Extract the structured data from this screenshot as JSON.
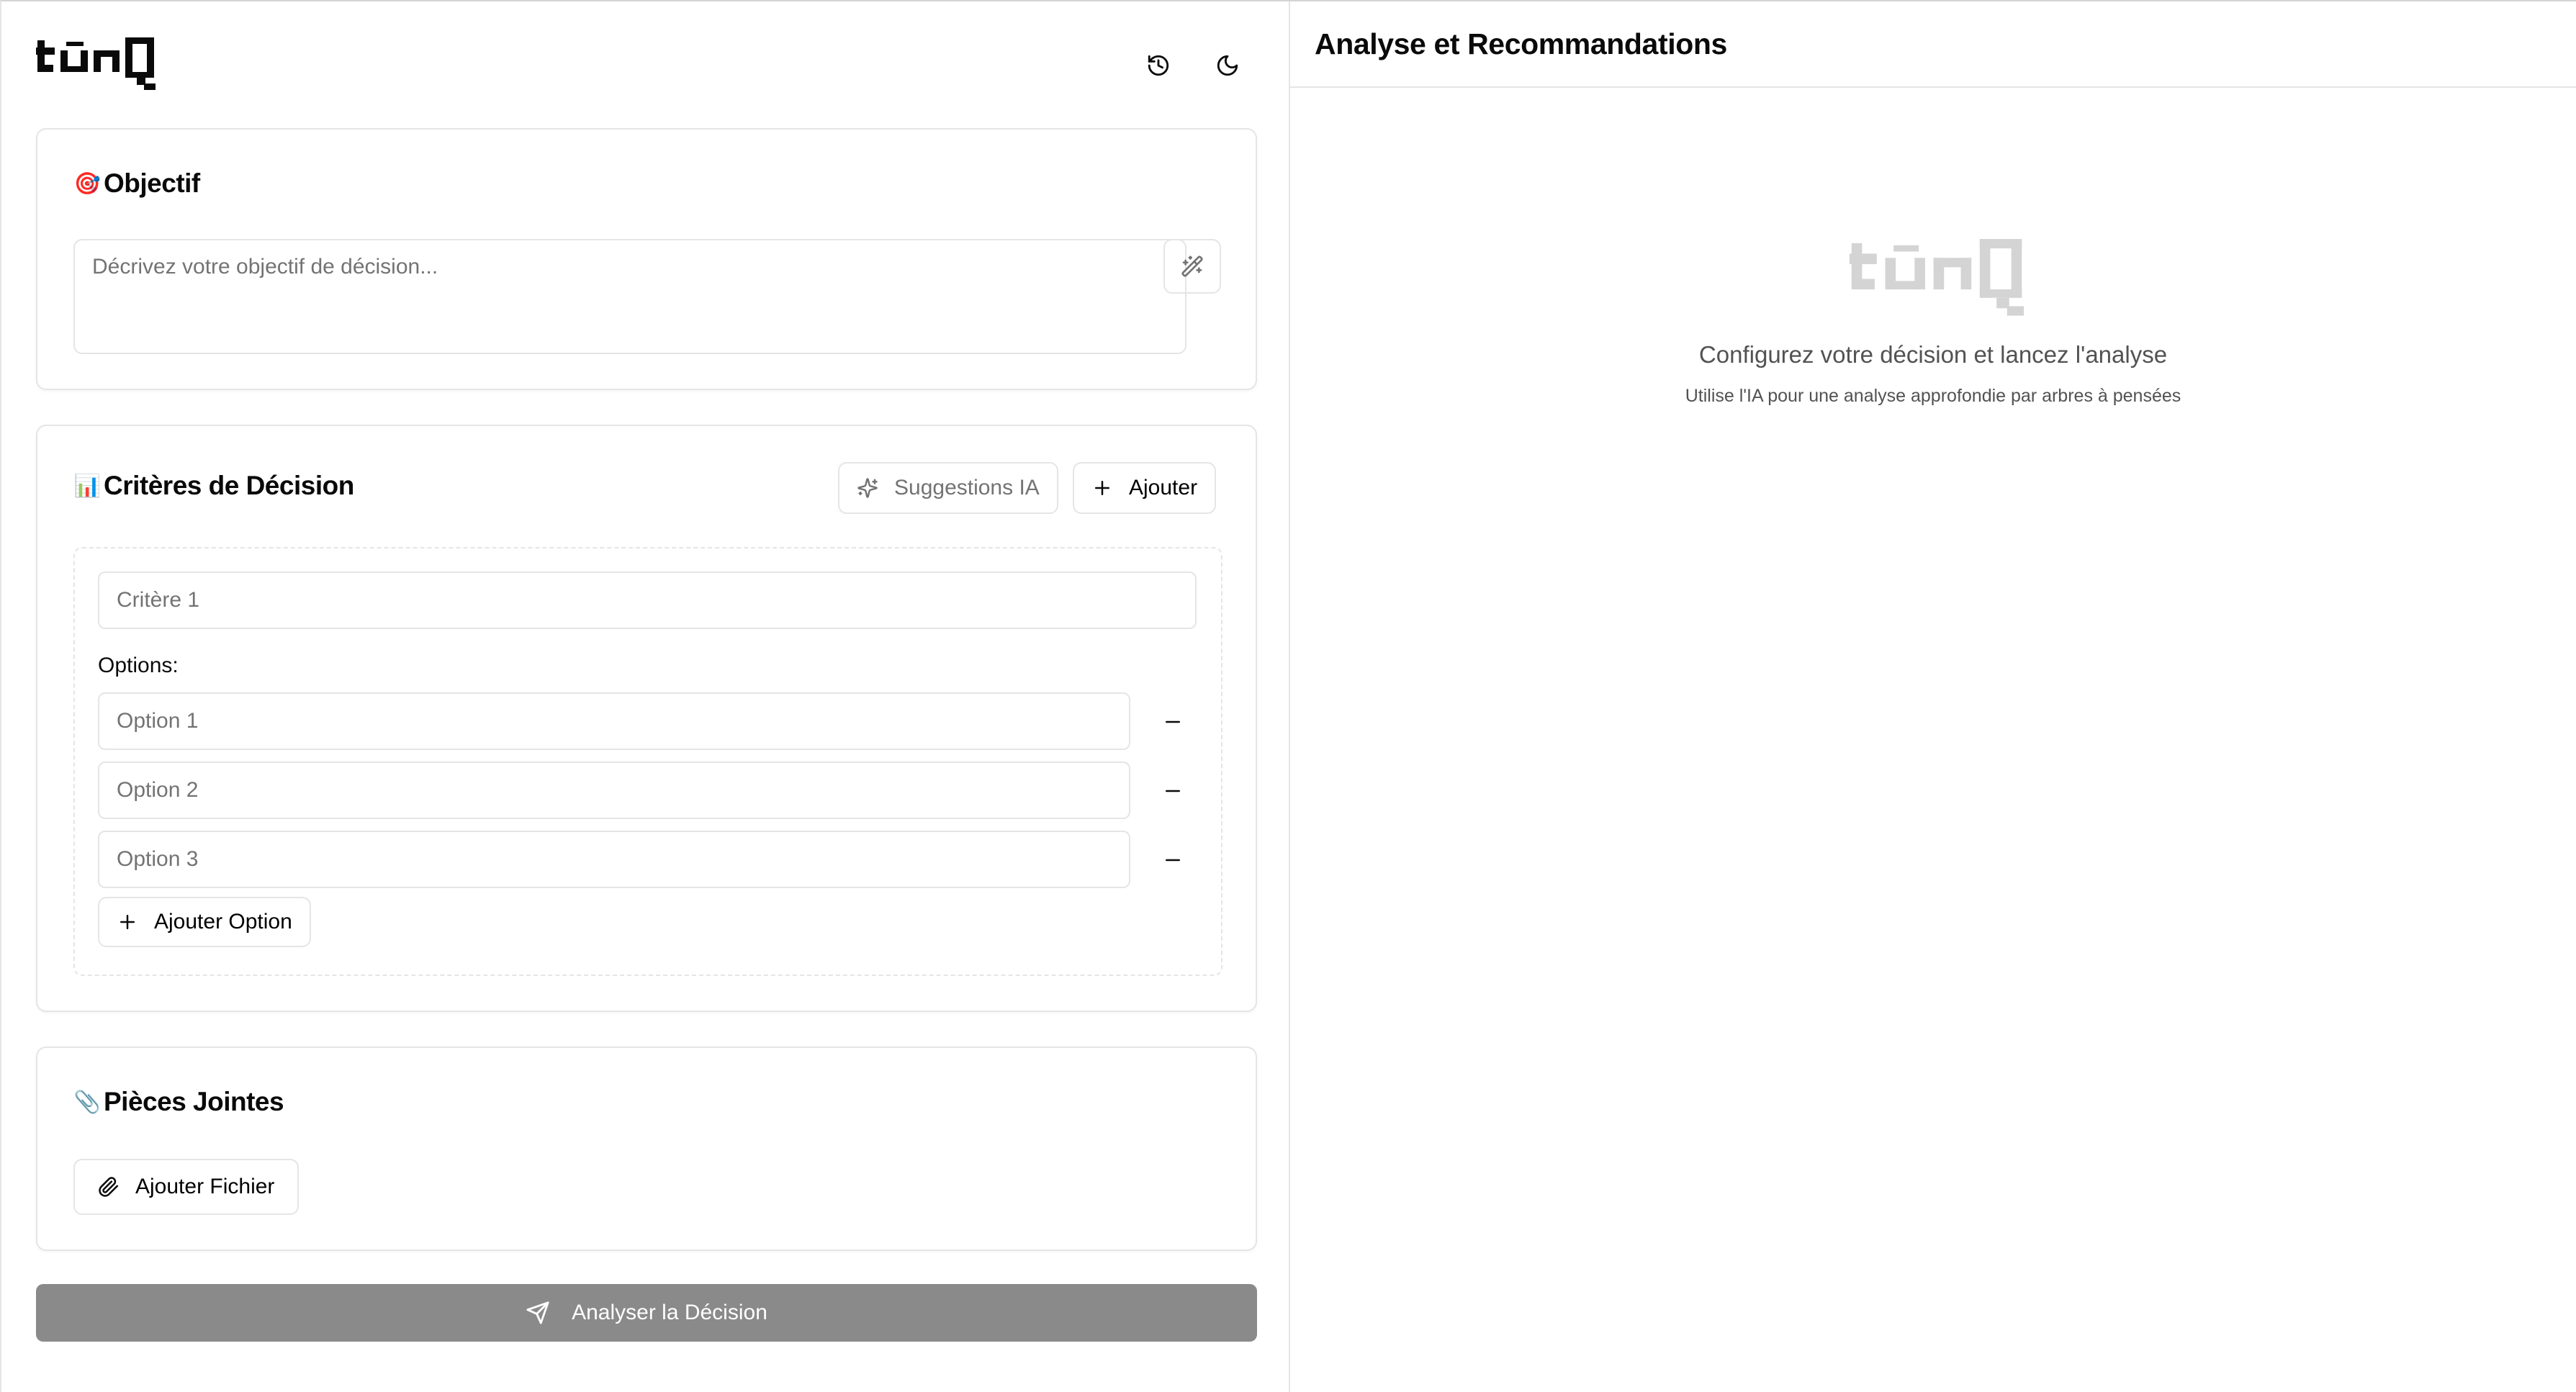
{
  "header": {
    "logo_text": "tūnQ",
    "history_icon": "history-icon",
    "theme_icon": "moon-icon"
  },
  "objective": {
    "title": "Objectif",
    "emoji": "🎯",
    "placeholder": "Décrivez votre objectif de décision...",
    "wand_icon": "wand-sparkles-icon"
  },
  "criteria": {
    "title": "Critères de Décision",
    "emoji": "📊",
    "suggestions_label": "Suggestions IA",
    "add_label": "Ajouter",
    "criterion_placeholder": "Critère 1",
    "options_label": "Options:",
    "options": [
      {
        "placeholder": "Option 1"
      },
      {
        "placeholder": "Option 2"
      },
      {
        "placeholder": "Option 3"
      }
    ],
    "add_option_label": "Ajouter Option"
  },
  "attachments": {
    "title": "Pièces Jointes",
    "emoji": "📎",
    "add_file_label": "Ajouter Fichier"
  },
  "analyze_button": {
    "label": "Analyser la Décision",
    "disabled": true
  },
  "analysis_panel": {
    "title": "Analyse et Recommandations",
    "empty_title": "Configurez votre décision et lancez l'analyse",
    "empty_subtitle": "Utilise l'IA pour une analyse approfondie par arbres à pensées"
  },
  "colors": {
    "border": "#e5e5e5",
    "muted_text": "#737373",
    "disabled_button": "#8a8a8a",
    "logo_muted": "#d4d4d4"
  }
}
